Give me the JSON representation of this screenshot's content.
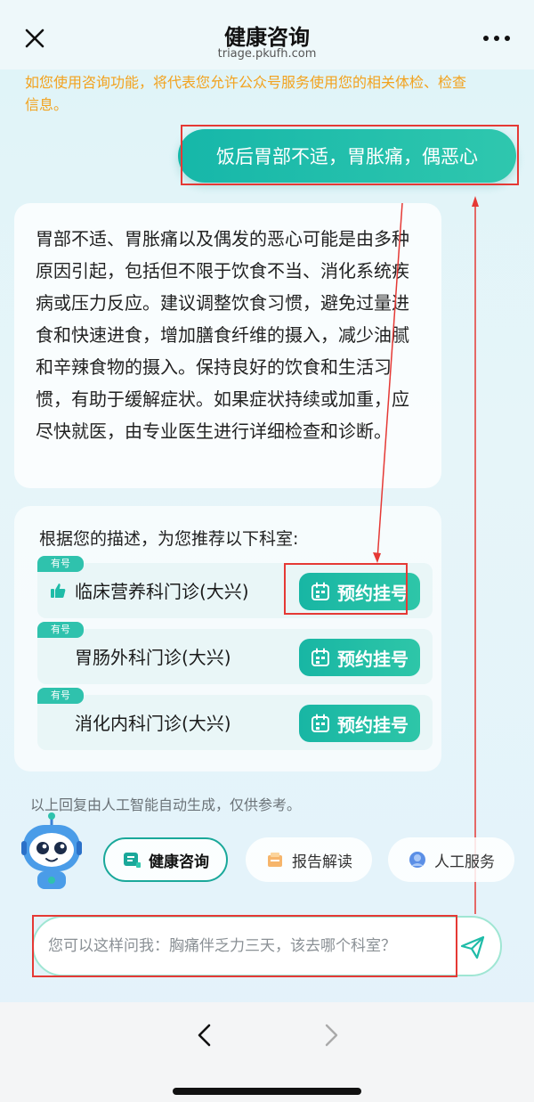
{
  "header": {
    "title": "健康咨询",
    "domain": "triage.pkufh.com"
  },
  "notice": "如您使用咨询功能，将代表您允许公众号服务使用您的相关体检、检查信息。",
  "user_message": "饭后胃部不适，胃胀痛，偶恶心",
  "answer": "胃部不适、胃胀痛以及偶发的恶心可能是由多种原因引起，包括但不限于饮食不当、消化系统疾病或压力反应。建议调整饮食习惯，避免过量进食和快速进食，增加膳食纤维的摄入，减少油腻和辛辣食物的摄入。保持良好的饮食和生活习惯，有助于缓解症状。如果症状持续或加重，应尽快就医，由专业医生进行详细检查和诊断。",
  "recommend": {
    "heading": "根据您的描述，为您推荐以下科室:",
    "departments": [
      {
        "badge": "有号",
        "name": "临床营养科门诊(大兴)",
        "button": "预约挂号",
        "recommended": true
      },
      {
        "badge": "有号",
        "name": "胃肠外科门诊(大兴)",
        "button": "预约挂号",
        "recommended": false
      },
      {
        "badge": "有号",
        "name": "消化内科门诊(大兴)",
        "button": "预约挂号",
        "recommended": false
      }
    ]
  },
  "disclaimer": "以上回复由人工智能自动生成，仅供参考。",
  "quick_actions": [
    {
      "label": "健康咨询",
      "icon": "chat-icon",
      "active": true
    },
    {
      "label": "报告解读",
      "icon": "report-icon",
      "active": false
    },
    {
      "label": "人工服务",
      "icon": "service-icon",
      "active": false
    }
  ],
  "input": {
    "placeholder": "您可以这样问我：胸痛伴乏力三天，该去哪个科室？"
  },
  "colors": {
    "accent": "#1fbca8",
    "notice": "#f2a21e",
    "annotation": "#e53935"
  }
}
